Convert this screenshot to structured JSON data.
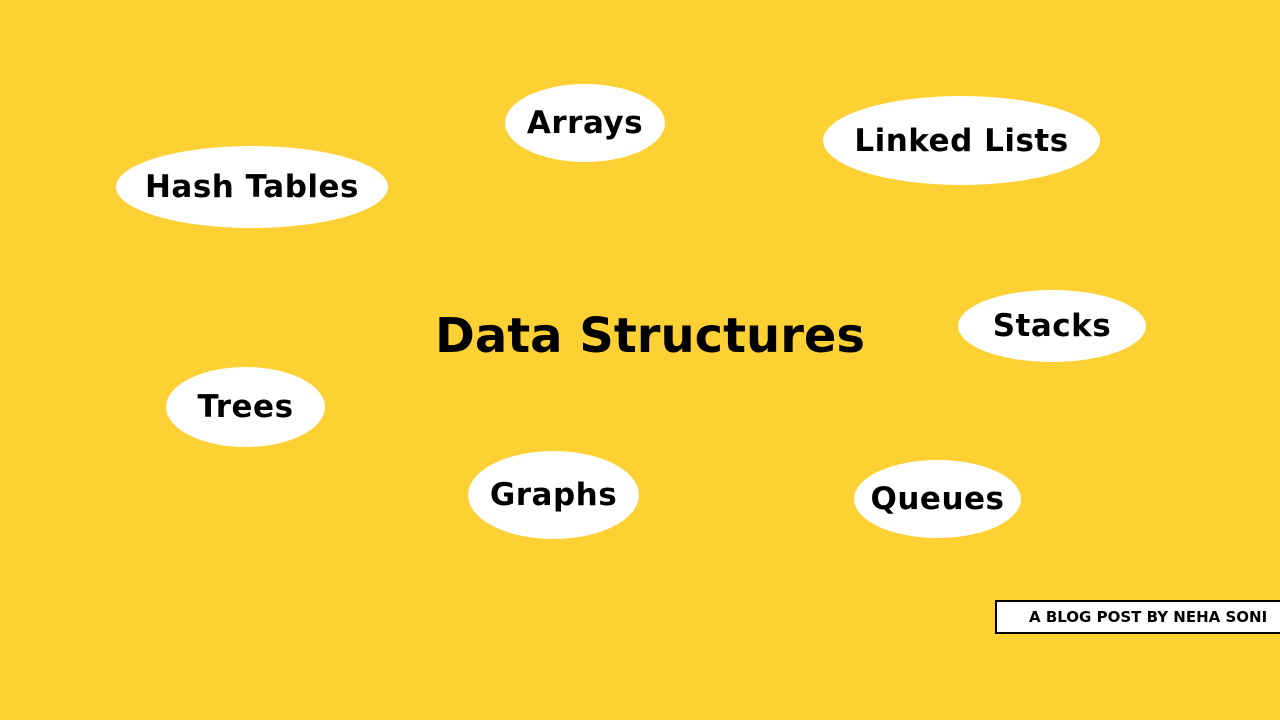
{
  "title": "Data Structures",
  "bubbles": {
    "arrays": "Arrays",
    "linked_lists": "Linked Lists",
    "hash_tables": "Hash Tables",
    "stacks": "Stacks",
    "trees": "Trees",
    "graphs": "Graphs",
    "queues": "Queues"
  },
  "credit": "A BLOG POST BY NEHA SONI",
  "colors": {
    "background": "#FDD033",
    "bubble": "#FFFFFF",
    "text": "#000000"
  }
}
